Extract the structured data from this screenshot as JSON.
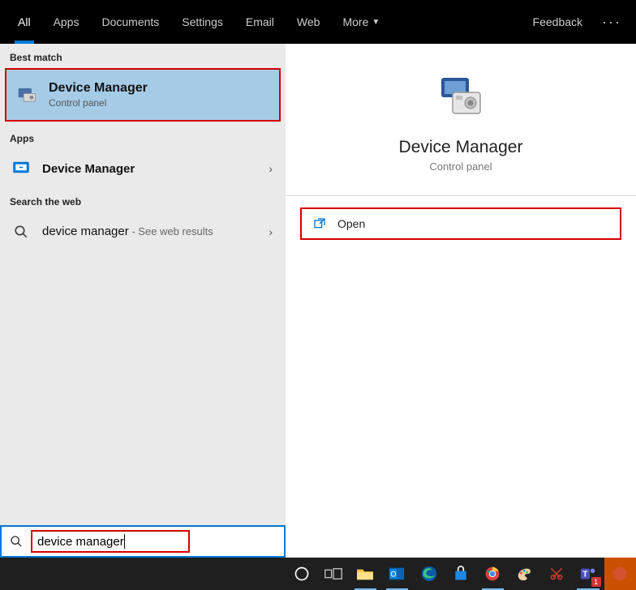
{
  "topbar": {
    "tabs": {
      "all": "All",
      "apps": "Apps",
      "documents": "Documents",
      "settings": "Settings",
      "email": "Email",
      "web": "Web",
      "more": "More"
    },
    "feedback": "Feedback"
  },
  "left": {
    "best_match_label": "Best match",
    "best_match": {
      "title": "Device Manager",
      "subtitle": "Control panel"
    },
    "apps_label": "Apps",
    "apps_item": {
      "title": "Device Manager"
    },
    "search_web_label": "Search the web",
    "web_item": {
      "query": "device manager",
      "suffix": " - See web results"
    }
  },
  "detail": {
    "title": "Device Manager",
    "subtitle": "Control panel",
    "open": "Open"
  },
  "search": {
    "value": "device manager"
  },
  "colors": {
    "accent": "#0078d4",
    "highlight_box": "#d40000",
    "selection": "#a6cbe7"
  }
}
